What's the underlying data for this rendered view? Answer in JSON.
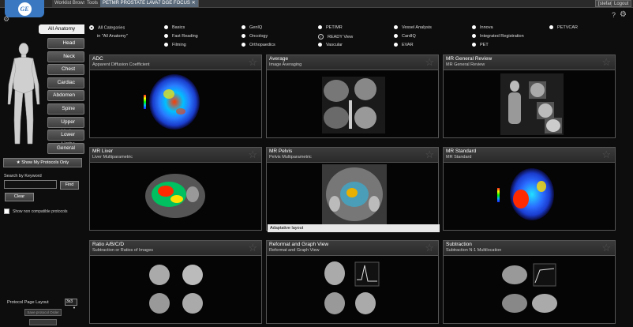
{
  "header": {
    "tabs": [
      {
        "label": "Worklist Browser"
      },
      {
        "label": "Tools"
      },
      {
        "label": "PETMR PROSTATE LAVA7 DGE FOCUS",
        "close": "✕"
      }
    ],
    "user_label": "[stefan]",
    "logout_label": "Logout",
    "help": "?"
  },
  "anatomy": {
    "all_label": "All Anatomy",
    "items": [
      "Head",
      "Neck",
      "Chest",
      "Cardiac",
      "Abdomen",
      "Spine",
      "Upper Limbs",
      "Lower Limbs",
      "General"
    ]
  },
  "filters": {
    "col1": [
      {
        "label": "All Categories",
        "sub": "in \"All Anatomy\""
      }
    ],
    "col2": [
      "Basics",
      "Fast Reading",
      "Filming"
    ],
    "col3": [
      "GenIQ",
      "Oncology",
      "Orthopaedics"
    ],
    "col4": [
      "PET/MR",
      "READY View",
      "Vascular"
    ],
    "col5": [
      "Vessel Analysis",
      "CardIQ",
      "EVAR"
    ],
    "col6": [
      "Innova",
      "Integrated Registration",
      "PET"
    ],
    "col7": [
      "PETVCAR"
    ]
  },
  "sidebar": {
    "show_my": "Show My Protocols Only",
    "search_label": "Search by Keyword",
    "search_value": "",
    "find": "Find",
    "clear": "Clear",
    "show_compat": "Show non compatible protocols",
    "ppl_label": "Protocol Page Layout",
    "ppl_value": "3x3",
    "save_order": "Save protocol Order"
  },
  "protocols": [
    {
      "title": "ADC",
      "sub": "Apparent Diffusion Coefficient"
    },
    {
      "title": "Average",
      "sub": "Image Averaging"
    },
    {
      "title": "MR General Review",
      "sub": "MR General Review"
    },
    {
      "title": "MR Liver",
      "sub": "Liver Multiparametric"
    },
    {
      "title": "MR Pelvis",
      "sub": "Pelvis Multiparametric",
      "caption": "Adaptative layout"
    },
    {
      "title": "MR Standard",
      "sub": "MR Standard"
    },
    {
      "title": "Ratio A/B/C/D",
      "sub": "Subtraction or Ratios of Images"
    },
    {
      "title": "Reformat and Graph View",
      "sub": "Reformat and Graph View"
    },
    {
      "title": "Subtraction",
      "sub": "Subtraction N-1 Multilocation"
    }
  ],
  "icons": {
    "star": "☆",
    "gear": "⚙",
    "settings": "⚙"
  }
}
